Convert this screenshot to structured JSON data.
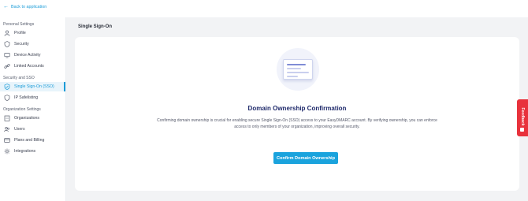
{
  "header": {
    "back_label": "Back to application"
  },
  "sidebar": {
    "personal_title": "Personal Settings",
    "personal_items": [
      {
        "label": "Profile",
        "icon": "user-icon"
      },
      {
        "label": "Security",
        "icon": "shield-icon"
      },
      {
        "label": "Device Activity",
        "icon": "device-icon"
      },
      {
        "label": "Linked Accounts",
        "icon": "link-icon"
      }
    ],
    "sso_title": "Security and SSO",
    "sso_items": [
      {
        "label": "Single Sign-On (SSO)",
        "icon": "shield-check-icon",
        "active": true
      },
      {
        "label": "IP Safelisting",
        "icon": "shield-icon"
      }
    ],
    "org_title": "Organization Settings",
    "org_items": [
      {
        "label": "Organizations",
        "icon": "building-icon"
      },
      {
        "label": "Users",
        "icon": "users-icon"
      },
      {
        "label": "Plans and Billing",
        "icon": "card-icon"
      },
      {
        "label": "Integrations",
        "icon": "gear-icon"
      }
    ]
  },
  "main": {
    "page_title": "Single Sign-On",
    "confirm_title": "Domain Ownership Confirmation",
    "description": "Confirming domain ownership is crucial for enabling secure Single Sign-On (SSO) access to your EasyDMARC account. By verifying ownership, you can enforce access to only members of your organization, improving overall security.",
    "button_label": "Confirm Domain Ownership"
  },
  "feedback": {
    "label": "Feedback"
  },
  "colors": {
    "accent": "#1aa3dd",
    "title": "#1f2a6b",
    "feedback": "#e8323c"
  }
}
